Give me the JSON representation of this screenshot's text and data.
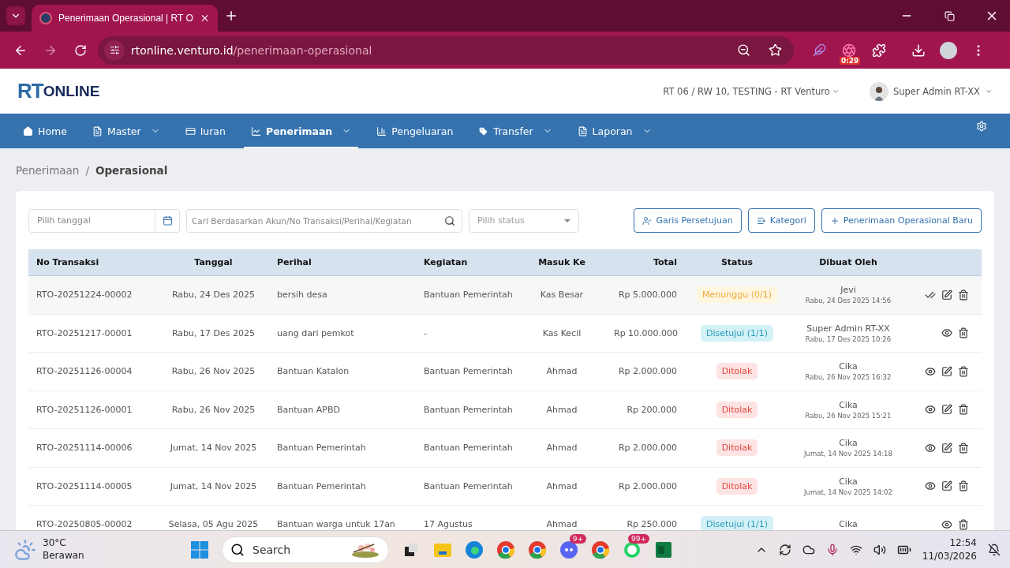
{
  "browser": {
    "tab_title": "Penerimaan Operasional | RT O",
    "url_host": "rtonline.venturo.id",
    "url_path": "/penerimaan-operasional",
    "extension_badge": "0:29"
  },
  "header": {
    "logo": {
      "prefix": "RT",
      "suffix": "ONLINE"
    },
    "location": "RT 06 / RW 10, TESTING - RT Venturo",
    "user": "Super Admin RT-XX"
  },
  "nav": [
    {
      "label": "Home",
      "selected": false,
      "dropdown": false
    },
    {
      "label": "Master",
      "selected": false,
      "dropdown": true
    },
    {
      "label": "Iuran",
      "selected": false,
      "dropdown": false
    },
    {
      "label": "Penerimaan",
      "selected": true,
      "dropdown": true
    },
    {
      "label": "Pengeluaran",
      "selected": false,
      "dropdown": false
    },
    {
      "label": "Transfer",
      "selected": false,
      "dropdown": true
    },
    {
      "label": "Laporan",
      "selected": false,
      "dropdown": true
    }
  ],
  "breadcrumb": {
    "items": [
      "Penerimaan",
      "Operasional"
    ],
    "separator": "/"
  },
  "filters": {
    "date_placeholder": "Pilih tanggal",
    "search_placeholder": "Cari Berdasarkan Akun/No Transaksi/Perihal/Kegiatan",
    "status_placeholder": "Pilih status"
  },
  "buttons": [
    "Garis Persetujuan",
    "Kategori",
    "Penerimaan Operasional Baru"
  ],
  "table": {
    "columns": [
      "No Transaksi",
      "Tanggal",
      "Perihal",
      "Kegiatan",
      "Masuk Ke",
      "Total",
      "Status",
      "Dibuat Oleh"
    ],
    "rows": [
      {
        "no": "RTO-20251224-00002",
        "tanggal": "Rabu, 24 Des 2025",
        "perihal": "bersih desa",
        "kegiatan": "Bantuan Pemerintah",
        "masuk_ke": "Kas Besar",
        "total": "Rp 5.000.000",
        "status": {
          "label": "Menunggu (0/1)",
          "kind": "pending"
        },
        "created_by": "Jevi",
        "created_at": "Rabu, 24 Des 2025 14:56",
        "actions": [
          {
            "kind": "approve"
          },
          {
            "kind": "edit"
          },
          {
            "kind": "delete"
          }
        ]
      },
      {
        "no": "RTO-20251217-00001",
        "tanggal": "Rabu, 17 Des 2025",
        "perihal": "uang dari pemkot",
        "kegiatan": "-",
        "masuk_ke": "Kas Kecil",
        "total": "Rp 10.000.000",
        "status": {
          "label": "Disetujui (1/1)",
          "kind": "approved"
        },
        "created_by": "Super Admin RT-XX",
        "created_at": "Rabu, 17 Des 2025 10:26",
        "actions": [
          {
            "kind": "view"
          },
          {
            "kind": "delete"
          }
        ]
      },
      {
        "no": "RTO-20251126-00004",
        "tanggal": "Rabu, 26 Nov 2025",
        "perihal": "Bantuan Katalon",
        "kegiatan": "Bantuan Pemerintah",
        "masuk_ke": "Ahmad",
        "total": "Rp 2.000.000",
        "status": {
          "label": "Ditolak",
          "kind": "rejected"
        },
        "created_by": "Cika",
        "created_at": "Rabu, 26 Nov 2025 16:32",
        "actions": [
          {
            "kind": "view"
          },
          {
            "kind": "edit"
          },
          {
            "kind": "delete"
          }
        ]
      },
      {
        "no": "RTO-20251126-00001",
        "tanggal": "Rabu, 26 Nov 2025",
        "perihal": "Bantuan APBD",
        "kegiatan": "Bantuan Pemerintah",
        "masuk_ke": "Ahmad",
        "total": "Rp 200.000",
        "status": {
          "label": "Ditolak",
          "kind": "rejected"
        },
        "created_by": "Cika",
        "created_at": "Rabu, 26 Nov 2025 15:21",
        "actions": [
          {
            "kind": "view"
          },
          {
            "kind": "edit"
          },
          {
            "kind": "delete"
          }
        ]
      },
      {
        "no": "RTO-20251114-00006",
        "tanggal": "Jumat, 14 Nov 2025",
        "perihal": "Bantuan Pemerintah",
        "kegiatan": "Bantuan Pemerintah",
        "masuk_ke": "Ahmad",
        "total": "Rp 2.000.000",
        "status": {
          "label": "Ditolak",
          "kind": "rejected"
        },
        "created_by": "Cika",
        "created_at": "Jumat, 14 Nov 2025 14:18",
        "actions": [
          {
            "kind": "view"
          },
          {
            "kind": "edit"
          },
          {
            "kind": "delete"
          }
        ]
      },
      {
        "no": "RTO-20251114-00005",
        "tanggal": "Jumat, 14 Nov 2025",
        "perihal": "Bantuan Pemerintah",
        "kegiatan": "Bantuan Pemerintah",
        "masuk_ke": "Ahmad",
        "total": "Rp 2.000.000",
        "status": {
          "label": "Ditolak",
          "kind": "rejected"
        },
        "created_by": "Cika",
        "created_at": "Jumat, 14 Nov 2025 14:02",
        "actions": [
          {
            "kind": "view"
          },
          {
            "kind": "edit"
          },
          {
            "kind": "delete"
          }
        ]
      },
      {
        "no": "RTO-20250805-00002",
        "tanggal": "Selasa, 05 Agu 2025",
        "perihal": "Bantuan warga untuk 17an",
        "kegiatan": "17 Agustus",
        "masuk_ke": "Ahmad",
        "total": "Rp 250.000",
        "status": {
          "label": "Disetujui (1/1)",
          "kind": "approved"
        },
        "created_by": "Cika",
        "actions": [
          {
            "kind": "view"
          },
          {
            "kind": "delete"
          }
        ]
      }
    ]
  },
  "taskbar": {
    "temperature": "30°C",
    "weather": "Berawan",
    "search_placeholder": "Search",
    "badges": [
      "9+",
      "99+"
    ],
    "time": "12:54",
    "date": "11/03/2026"
  }
}
